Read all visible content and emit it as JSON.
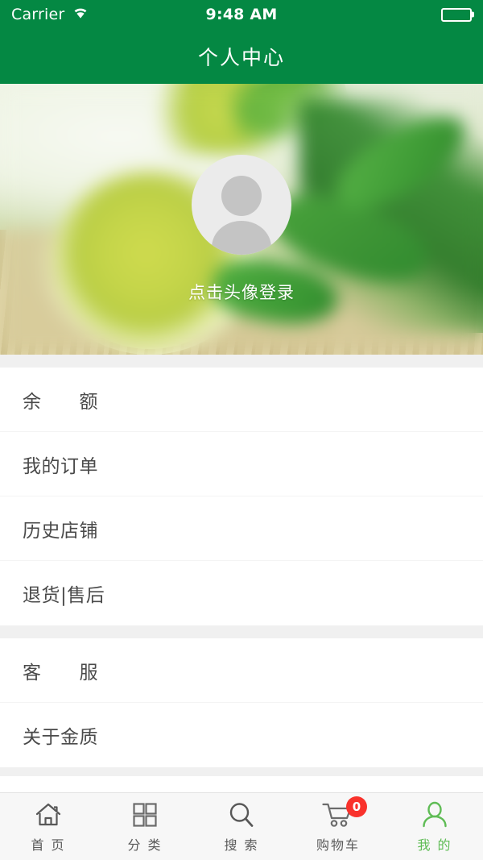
{
  "status_bar": {
    "carrier": "Carrier",
    "time": "9:48 AM",
    "wifi_icon": "wifi-icon",
    "battery_icon": "battery-full-icon"
  },
  "nav": {
    "title": "个人中心"
  },
  "profile": {
    "avatar_icon": "person-placeholder-icon",
    "login_prompt": "点击头像登录"
  },
  "menu_groups": [
    {
      "items": [
        {
          "label": "余　　额"
        },
        {
          "label": "我的订单"
        },
        {
          "label": "历史店铺"
        },
        {
          "label": "退货|售后"
        }
      ]
    },
    {
      "items": [
        {
          "label": "客　　服"
        },
        {
          "label": "关于金质"
        }
      ]
    }
  ],
  "tab_bar": {
    "items": [
      {
        "label": "首 页",
        "icon": "home-icon",
        "active": false
      },
      {
        "label": "分 类",
        "icon": "grid-icon",
        "active": false
      },
      {
        "label": "搜 索",
        "icon": "search-icon",
        "active": false
      },
      {
        "label": "购物车",
        "icon": "cart-icon",
        "active": false,
        "badge": "0"
      },
      {
        "label": "我 的",
        "icon": "person-icon",
        "active": true
      }
    ]
  },
  "colors": {
    "brand_green": "#048843",
    "active_tab_green": "#5fbc55",
    "badge_red": "#f9322c",
    "text_gray": "#4a4a4a",
    "tabbar_bg": "#f7f7f7"
  }
}
